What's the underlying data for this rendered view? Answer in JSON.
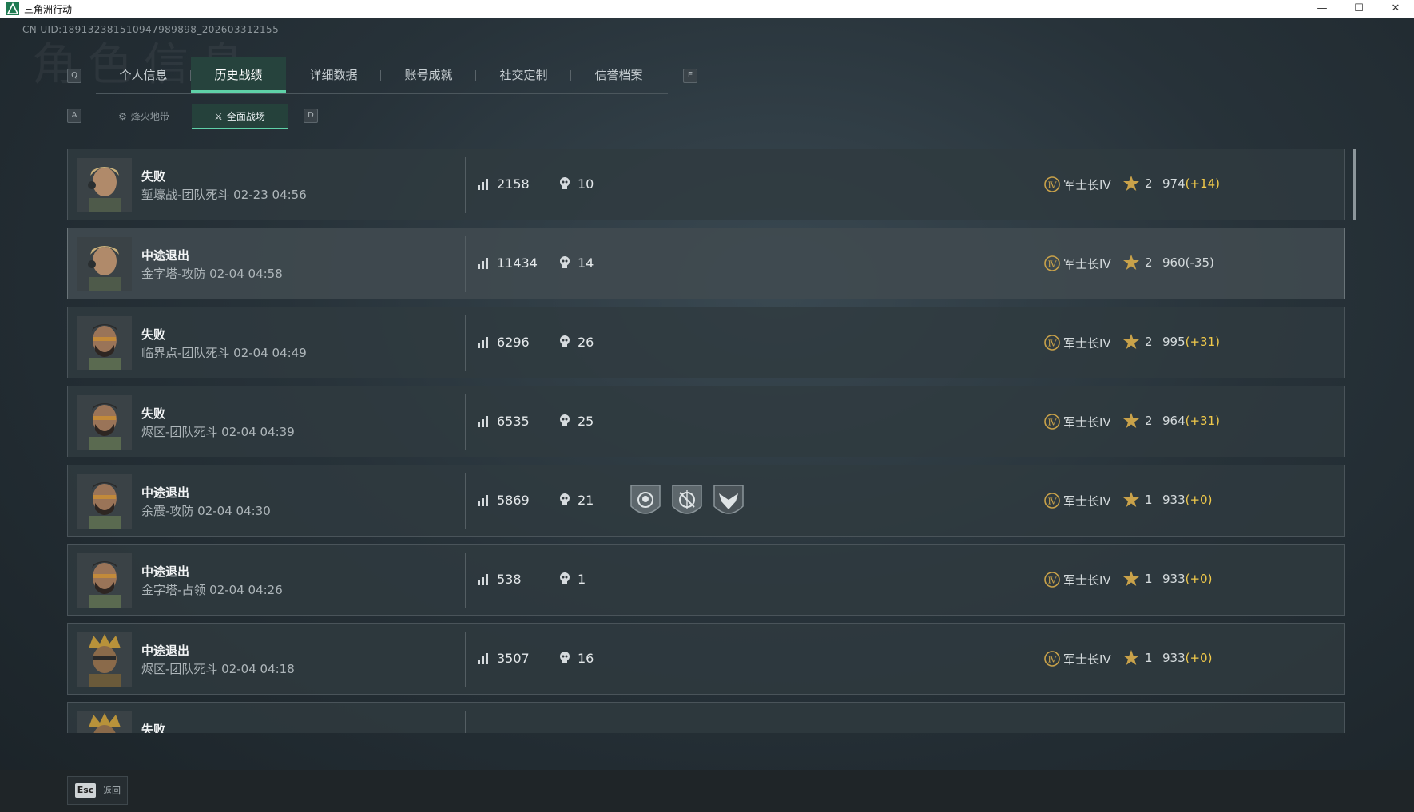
{
  "window": {
    "title": "三角洲行动",
    "minimize": "—",
    "maximize": "☐",
    "close": "✕"
  },
  "uid": "CN UID:18913238151094798989​8_2026​03312155",
  "watermark": "角色信息",
  "main_tabs": {
    "key_left": "Q",
    "key_right": "E",
    "items": [
      {
        "label": "个人信息",
        "active": false
      },
      {
        "label": "历史战绩",
        "active": true
      },
      {
        "label": "详细数据",
        "active": false
      },
      {
        "label": "账号成就",
        "active": false
      },
      {
        "label": "社交定制",
        "active": false
      },
      {
        "label": "信誉档案",
        "active": false
      }
    ]
  },
  "sub_tabs": {
    "key_left": "A",
    "key_right": "D",
    "items": [
      {
        "label": "烽火地带",
        "icon": "fire-zone-icon",
        "active": false
      },
      {
        "label": "全面战场",
        "icon": "battlefield-icon",
        "active": true
      }
    ]
  },
  "matches": [
    {
      "result": "失败",
      "detail": "堑壕战-团队死斗 02-23 04:56",
      "score": "2158",
      "kills": "10",
      "rank": "军士长IV",
      "stars": "2",
      "points": "974",
      "delta": "(+14)",
      "delta_type": "pos",
      "avatar": "operator-a",
      "medals": []
    },
    {
      "result": "中途退出",
      "detail": "金字塔-攻防 02-04 04:58",
      "score": "11434",
      "kills": "14",
      "rank": "军士长IV",
      "stars": "2",
      "points": "960",
      "delta": "(-35)",
      "delta_type": "neg",
      "avatar": "operator-a",
      "medals": []
    },
    {
      "result": "失败",
      "detail": "临界点-团队死斗 02-04 04:49",
      "score": "6296",
      "kills": "26",
      "rank": "军士长IV",
      "stars": "2",
      "points": "995",
      "delta": "(+31)",
      "delta_type": "pos",
      "avatar": "operator-b",
      "medals": []
    },
    {
      "result": "失败",
      "detail": "烬区-团队死斗 02-04 04:39",
      "score": "6535",
      "kills": "25",
      "rank": "军士长IV",
      "stars": "2",
      "points": "964",
      "delta": "(+31)",
      "delta_type": "pos",
      "avatar": "operator-b",
      "medals": []
    },
    {
      "result": "中途退出",
      "detail": "余震-攻防 02-04 04:30",
      "score": "5869",
      "kills": "21",
      "rank": "军士长IV",
      "stars": "1",
      "points": "933",
      "delta": "(+0)",
      "delta_type": "pos",
      "avatar": "operator-b",
      "medals": [
        "skull-medal-icon",
        "crosshair-medal-icon",
        "eagle-medal-icon"
      ]
    },
    {
      "result": "中途退出",
      "detail": "金字塔-占领 02-04 04:26",
      "score": "538",
      "kills": "1",
      "rank": "军士长IV",
      "stars": "1",
      "points": "933",
      "delta": "(+0)",
      "delta_type": "pos",
      "avatar": "operator-b",
      "medals": []
    },
    {
      "result": "中途退出",
      "detail": "烬区-团队死斗 02-04 04:18",
      "score": "3507",
      "kills": "16",
      "rank": "军士长IV",
      "stars": "1",
      "points": "933",
      "delta": "(+0)",
      "delta_type": "pos",
      "avatar": "operator-c",
      "medals": []
    },
    {
      "result": "失败",
      "detail": "",
      "score": "",
      "kills": "",
      "rank": "",
      "stars": "",
      "points": "",
      "delta": "",
      "delta_type": "pos",
      "avatar": "operator-c",
      "medals": []
    }
  ],
  "footer": {
    "esc_key": "Esc",
    "esc_label": "返回"
  },
  "colors": {
    "accent": "#5fd1a8",
    "gain": "#f0c94a",
    "rank_gold": "#c9a24a"
  }
}
